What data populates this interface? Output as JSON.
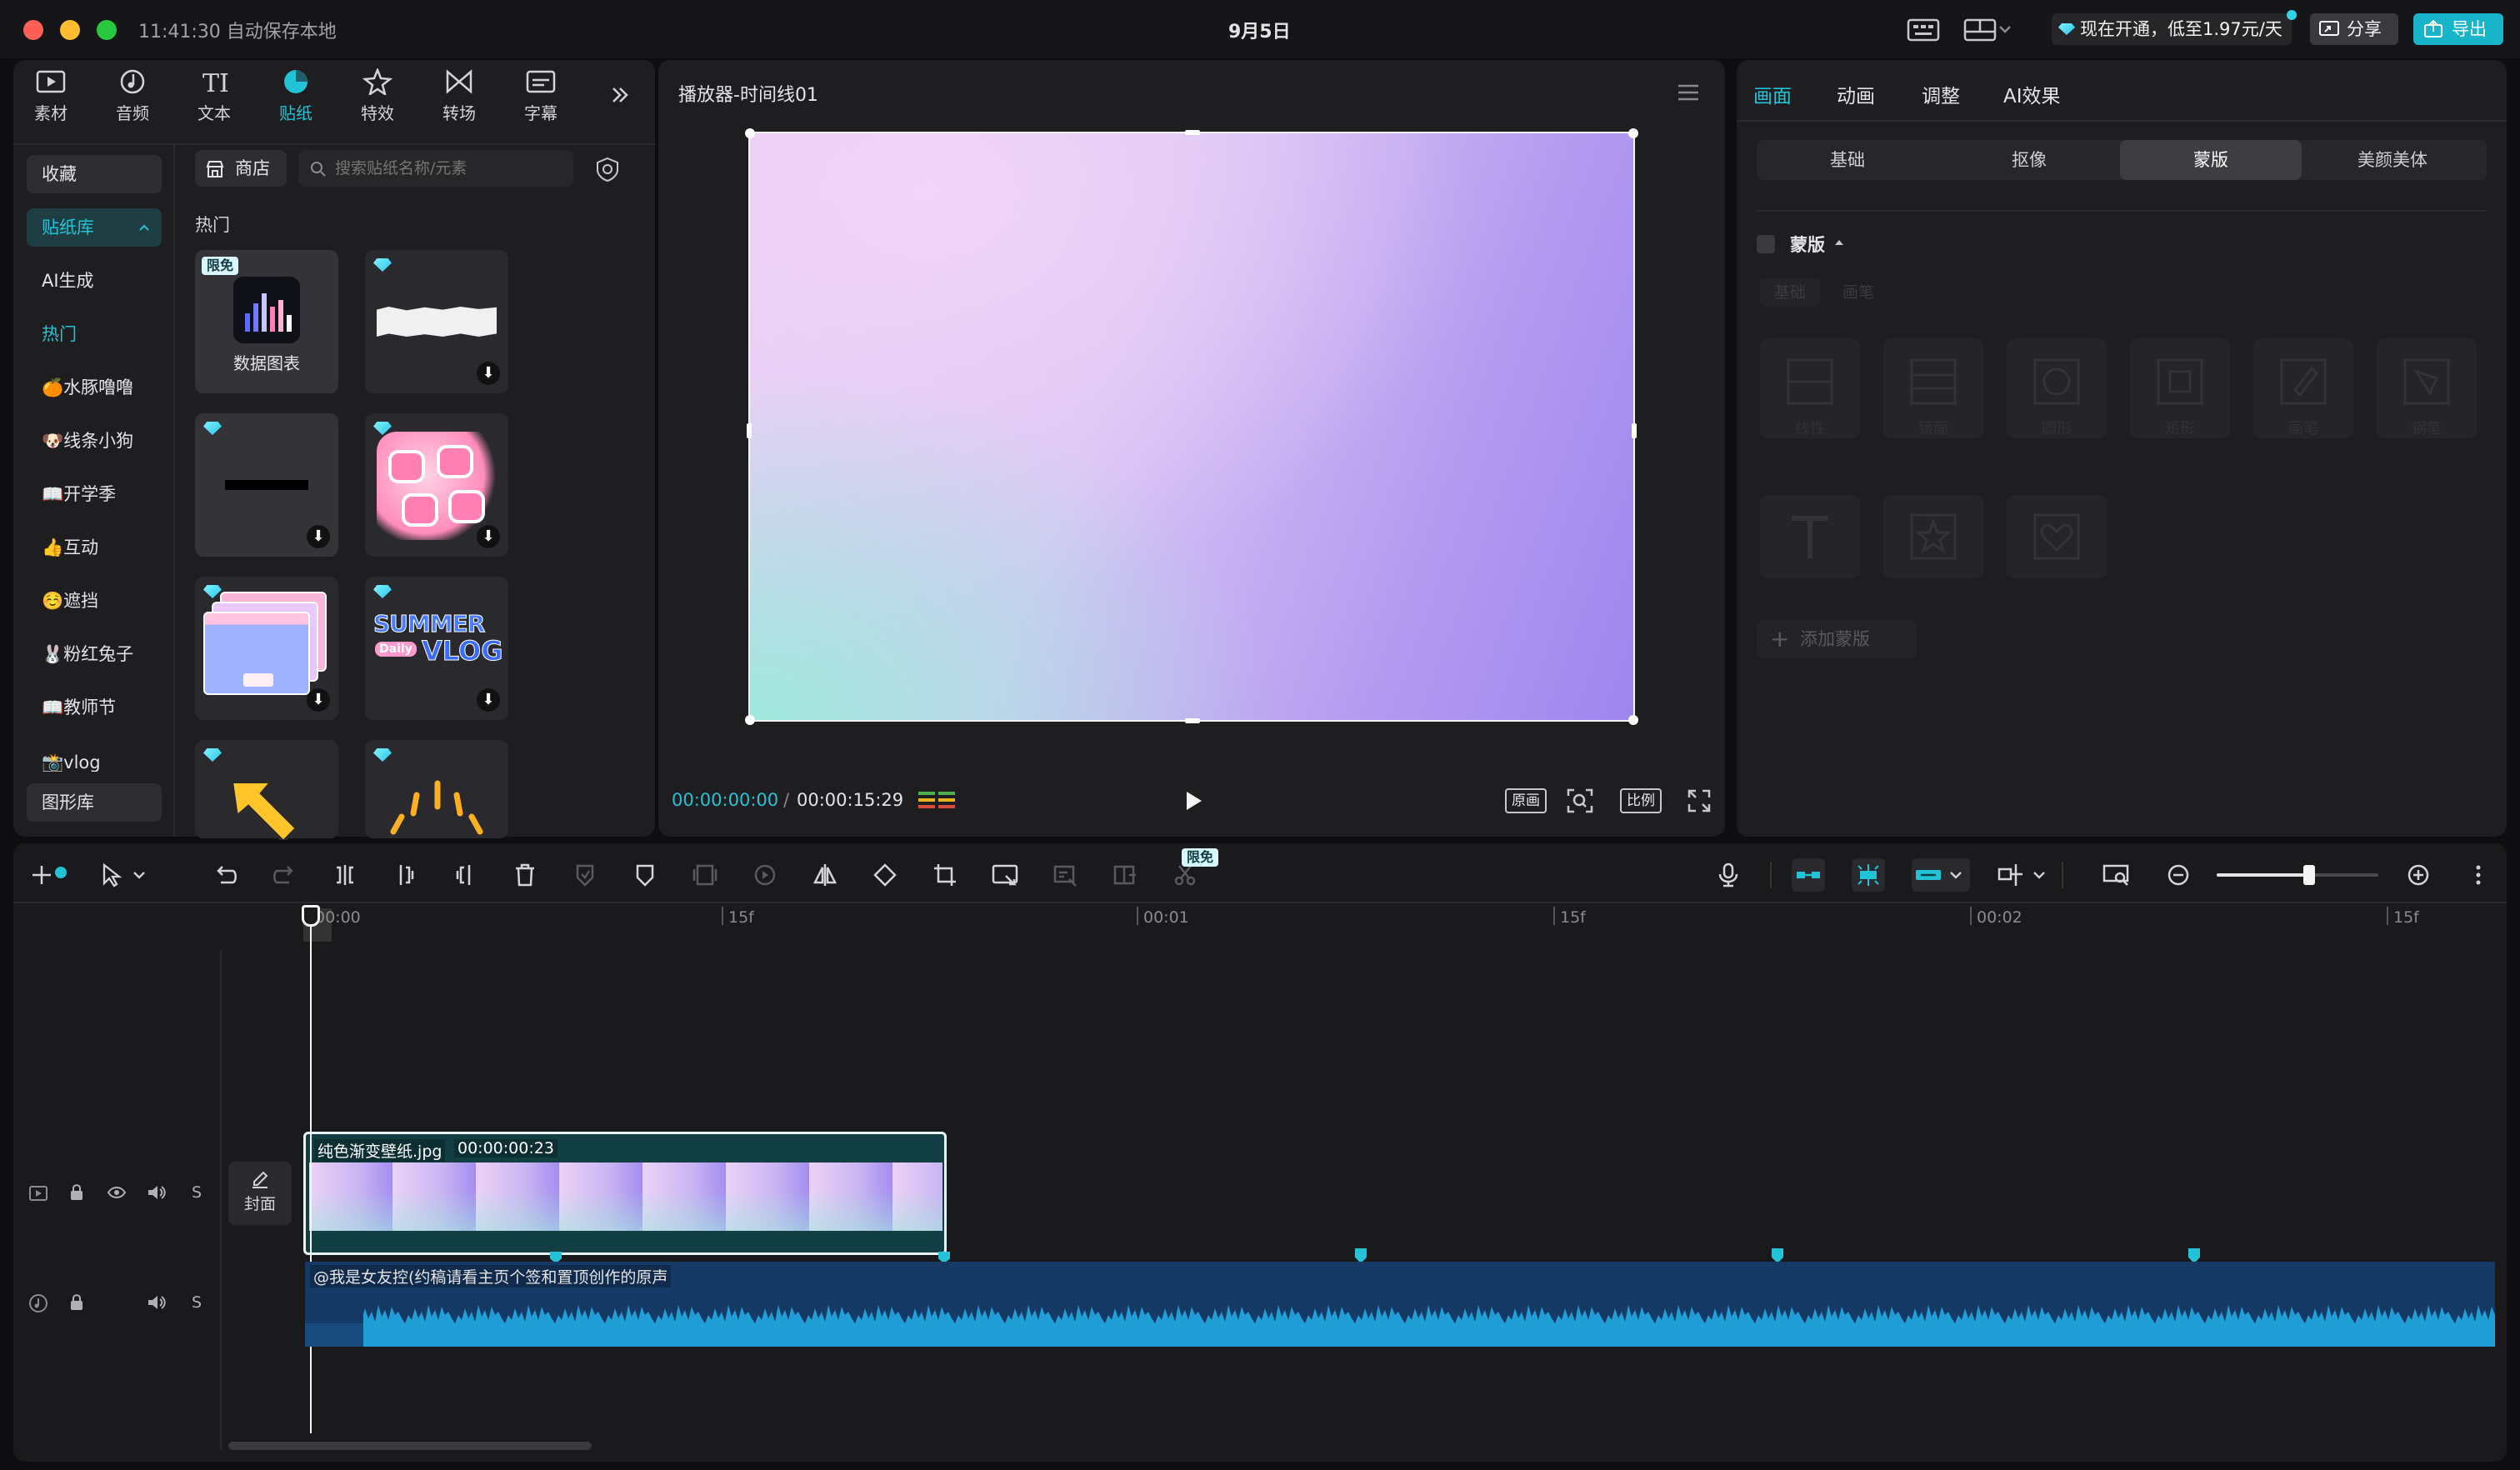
{
  "titlebar": {
    "time_save": "11:41:30 自动保存本地",
    "date": "9月5日",
    "promo": "现在开通，低至1.97元/天",
    "share": "分享",
    "export": "导出"
  },
  "media_tools": [
    {
      "label": "素材",
      "icon": "media-icon"
    },
    {
      "label": "音频",
      "icon": "audio-icon"
    },
    {
      "label": "文本",
      "icon": "text-icon"
    },
    {
      "label": "贴纸",
      "icon": "sticker-icon"
    },
    {
      "label": "特效",
      "icon": "effects-icon"
    },
    {
      "label": "转场",
      "icon": "transition-icon"
    },
    {
      "label": "字幕",
      "icon": "subtitle-icon"
    }
  ],
  "sidebar": {
    "items": [
      "收藏",
      "贴纸库",
      "AI生成",
      "热门",
      "🍊水豚噜噜",
      "🐶线条小狗",
      "📖开学季",
      "👍互动",
      "☺️遮挡",
      "🐰粉红兔子",
      "📖教师节",
      "📸vlog",
      "图形库"
    ]
  },
  "sticker_panel": {
    "store_label": "商店",
    "search_placeholder": "搜索贴纸名称/元素",
    "section_title": "热门",
    "first_card_badge": "限免",
    "first_card_label": "数据图表",
    "summer_text": "SUMMER",
    "vlog_text": "VLOG",
    "daily_text": "Daily"
  },
  "player": {
    "title": "播放器-时间线01",
    "current_time": "00:00:00:00",
    "total_time": "00:00:15:29",
    "btn_original": "原画",
    "btn_ratio": "比例"
  },
  "inspector": {
    "tabs": [
      "画面",
      "动画",
      "调整",
      "AI效果"
    ],
    "subtabs": [
      "基础",
      "抠像",
      "蒙版",
      "美颜美体"
    ],
    "mask_label": "蒙版",
    "add_mask": "添加蒙版",
    "ghost_tabs": [
      "基础",
      "画笔"
    ],
    "ghost_labels": [
      "线性",
      "镜面",
      "圆形",
      "矩形",
      "画笔",
      "钢笔"
    ]
  },
  "toolbar": {
    "badge": "限免"
  },
  "timeline": {
    "ticks": [
      "00:00",
      "15f",
      "00:01",
      "15f",
      "00:02",
      "15f"
    ],
    "cover_label": "封面",
    "clip_name": "纯色渐变壁纸.jpg",
    "clip_duration": "00:00:00:23",
    "audio_name": "@我是女友控(约稿请看主页个签和置顶创作的原声",
    "track_s": "S"
  },
  "colors": {
    "accent": "#22c3d6",
    "export_bg": "#18b4c9",
    "clip_border": "#1a7f85",
    "audio_bg": "#163a66"
  }
}
